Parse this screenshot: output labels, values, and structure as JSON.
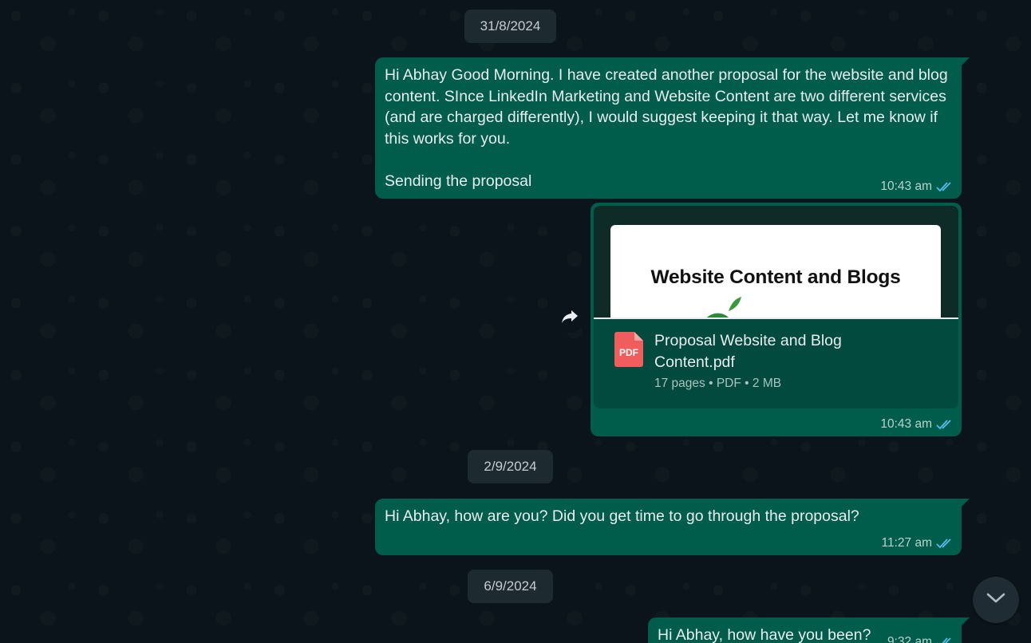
{
  "dates": {
    "d1": "31/8/2024",
    "d2": "2/9/2024",
    "d3": "6/9/2024"
  },
  "messages": {
    "m1": {
      "text": "Hi Abhay Good Morning. I have created another proposal for the website and blog content. SInce LinkedIn Marketing and Website Content are two different services (and are charged differently), I would suggest keeping it that way. Let me know if this works for you.\n\nSending the proposal",
      "time": "10:43 am"
    },
    "m2": {
      "preview_title": "Website Content and Blogs",
      "file_name": "Proposal Website and Blog Content.pdf",
      "file_type_label": "PDF",
      "pages": "17 pages",
      "type": "PDF",
      "size": "2 MB",
      "separator": "•",
      "time": "10:43 am"
    },
    "m3": {
      "text": "Hi Abhay, how are you? Did you get time to go through the proposal?",
      "time": "11:27 am"
    },
    "m4": {
      "text": "Hi Abhay, how have you been?",
      "time": "9:32 am"
    }
  },
  "colors": {
    "background": "#0b141a",
    "outgoing_bubble": "#005c4b",
    "read_ticks": "#53bdeb",
    "date_chip": "#1d2a30"
  },
  "icons": {
    "read_receipt": "double-check-icon",
    "forward": "forward-arrow-icon",
    "scroll_down": "chevron-down-icon",
    "file": "pdf-file-icon"
  }
}
